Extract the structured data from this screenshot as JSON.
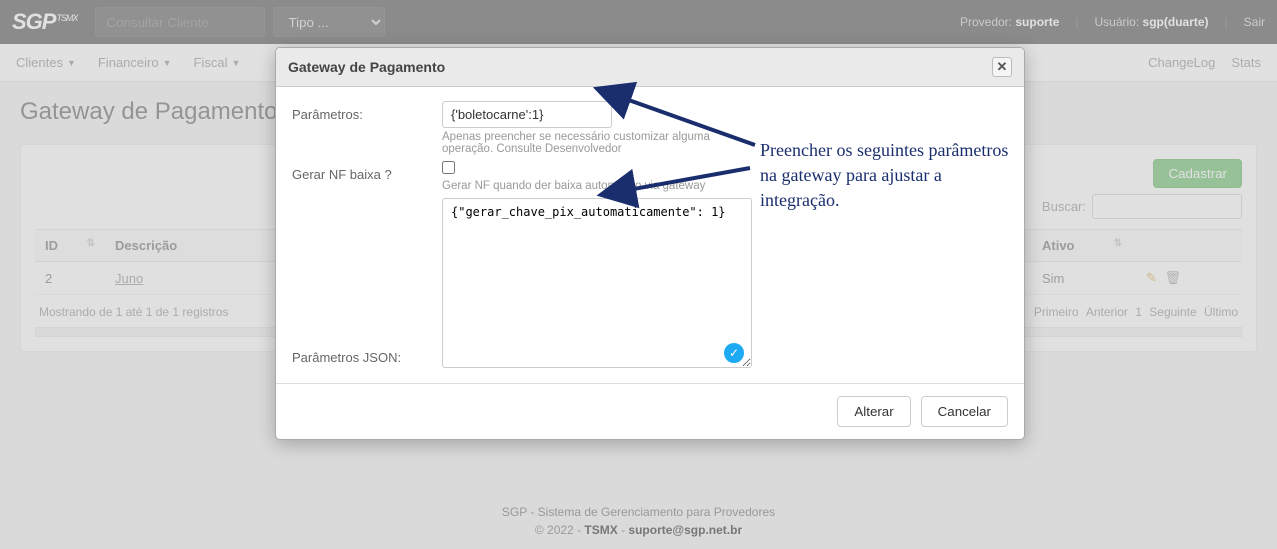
{
  "topbar": {
    "logo": "SGP",
    "logo_sub": "TSMX",
    "consultar_placeholder": "Consultar Cliente",
    "tipo_placeholder": "Tipo ...",
    "provedor_label": "Provedor:",
    "provedor_value": "suporte",
    "usuario_label": "Usuário:",
    "usuario_value": "sgp(duarte)",
    "sair": "Sair"
  },
  "nav": {
    "items": [
      "Clientes",
      "Financeiro",
      "Fiscal"
    ],
    "changelog": "ChangeLog",
    "stats": "Stats"
  },
  "page": {
    "title": "Gateway de Pagamento",
    "cadastrar": "Cadastrar",
    "buscar_label": "Buscar:"
  },
  "table": {
    "headers": [
      "ID",
      "Descrição",
      "Ativo",
      ""
    ],
    "rows": [
      {
        "id": "2",
        "descricao": "Juno",
        "ativo": "Sim"
      }
    ],
    "info": "Mostrando de 1 até 1 de 1 registros",
    "pager": {
      "primeiro": "Primeiro",
      "anterior": "Anterior",
      "page": "1",
      "seguinte": "Seguinte",
      "ultimo": "Último"
    }
  },
  "modal": {
    "title": "Gateway de Pagamento",
    "parametros_label": "Parâmetros:",
    "parametros_value": "{'boletocarne':1}",
    "parametros_help": "Apenas preencher se necessário customizar alguma operação. Consulte Desenvolvedor",
    "gerar_nf_label": "Gerar NF baixa ?",
    "gerar_nf_help": "Gerar NF quando der baixa automático via gateway",
    "parametros_json_label": "Parâmetros JSON:",
    "parametros_json_value": "{\"gerar_chave_pix_automaticamente\": 1}",
    "alterar": "Alterar",
    "cancelar": "Cancelar"
  },
  "annotation": {
    "text": "Preencher os seguintes parâmetros na gateway para ajustar a integração."
  },
  "footer": {
    "line1a": "SGP - Sistema de Gerenciamento para Provedores",
    "line2a": "© 2022 - ",
    "line2b": "TSMX",
    "line2c": " - ",
    "line2d": "suporte@sgp.net.br"
  }
}
